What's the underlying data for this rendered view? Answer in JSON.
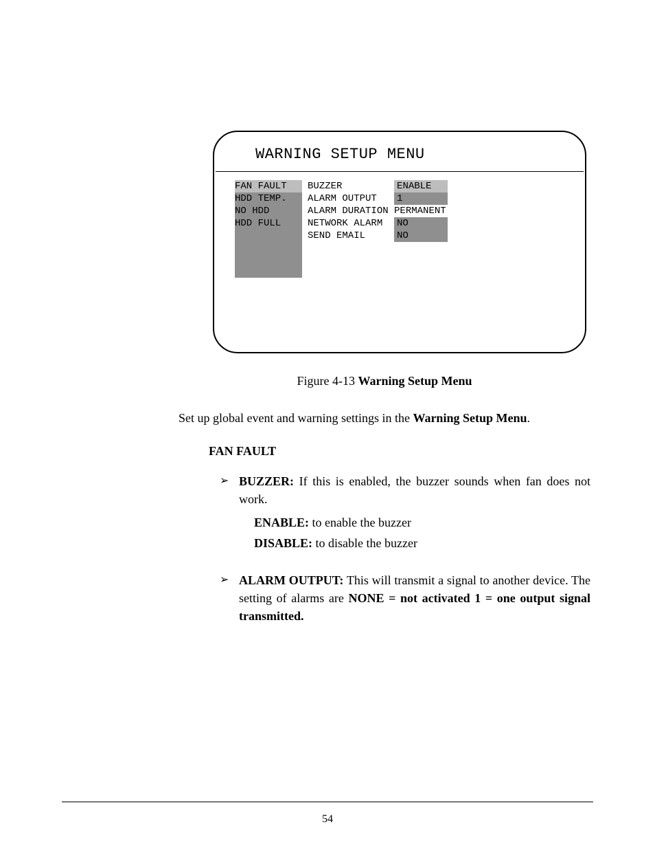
{
  "screenshot": {
    "title": "WARNING SETUP MENU",
    "left_items": [
      "FAN FAULT",
      "HDD TEMP.",
      "NO HDD",
      "HDD FULL"
    ],
    "left_selected_index": 0,
    "rows": [
      {
        "label": "BUZZER",
        "value": "ENABLE",
        "selected": true
      },
      {
        "label": "ALARM OUTPUT",
        "value": "1",
        "selected": false
      },
      {
        "label": "ALARM DURATION",
        "value": "PERMANENT",
        "plain": true
      },
      {
        "label": "NETWORK ALARM",
        "value": "NO",
        "selected": false
      },
      {
        "label": "SEND EMAIL",
        "value": "NO",
        "selected": false
      }
    ]
  },
  "fig": {
    "prefix": "Figure 4-13 ",
    "bold": "Warning Setup Menu"
  },
  "intro": {
    "line1a": "Set up global event and warning settings in the ",
    "line1b": "Warning Setup Menu",
    "line2": "."
  },
  "fan": {
    "heading": "FAN FAULT",
    "buzzer": {
      "label": "BUZZER:",
      "text": " If this is enabled, the buzzer sounds when fan does not work.",
      "enable_label": "ENABLE:",
      "enable_text": " to enable the buzzer",
      "disable_label": "DISABLE:",
      "disable_text": " to disable the buzzer"
    },
    "alarm_output": {
      "label": "ALARM OUTPUT:",
      "line1": " This will transmit a signal to another device. The setting of alarms are ",
      "none_bold": "NONE = not activated",
      "gap": "       ",
      "one_bold": "1 = one output signal transmitted."
    }
  },
  "page_number": "54"
}
